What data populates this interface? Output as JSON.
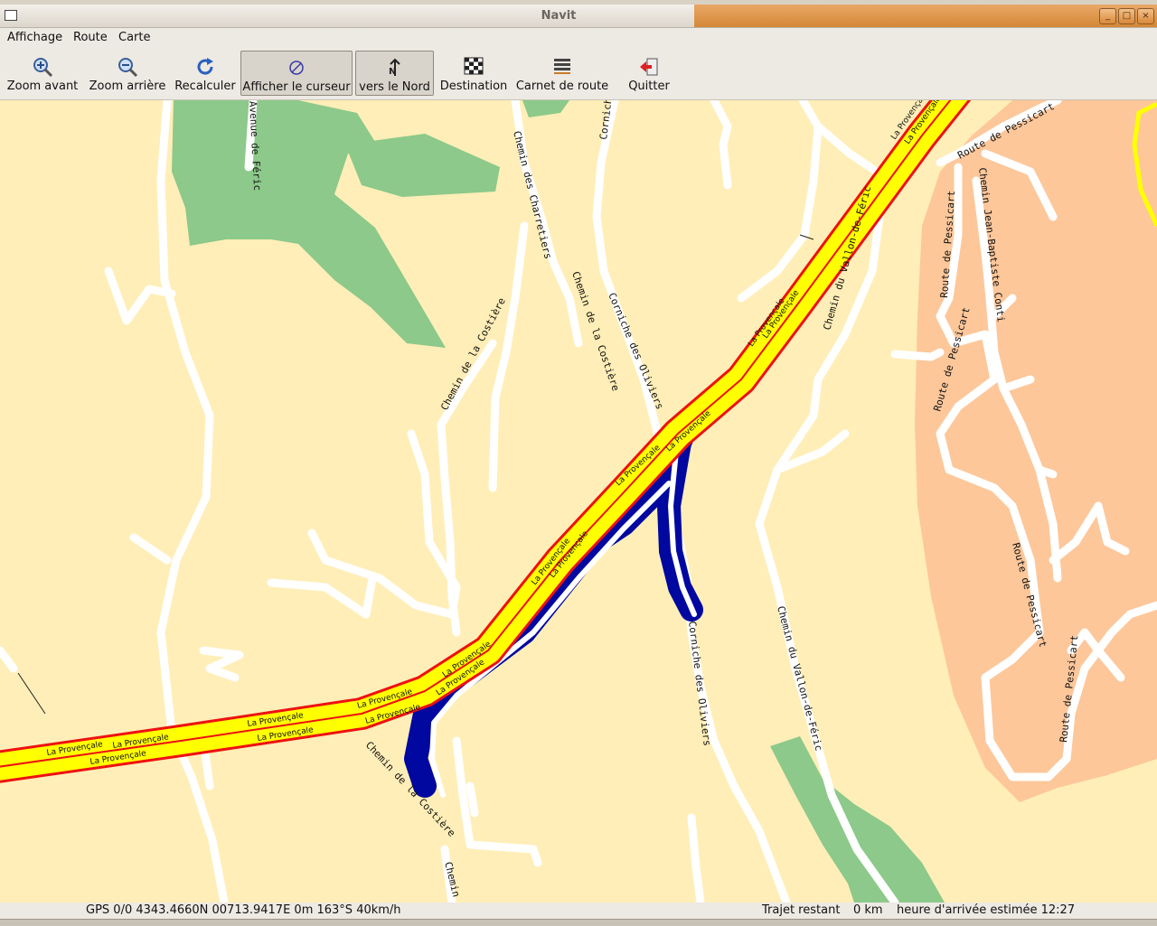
{
  "window": {
    "title": "Navit",
    "controls": [
      "_",
      "□",
      "×"
    ]
  },
  "menu": {
    "items": [
      {
        "label": "Affichage"
      },
      {
        "label": "Route"
      },
      {
        "label": "Carte"
      }
    ]
  },
  "toolbar": {
    "zoom_in": "Zoom avant",
    "zoom_out": "Zoom arrière",
    "recalculate": "Recalculer",
    "show_cursor": "Afficher le curseur",
    "north": "vers le Nord",
    "destination": "Destination",
    "roadbook": "Carnet de route",
    "quit": "Quitter"
  },
  "map": {
    "colors": {
      "land": "#ffeeb7",
      "park": "#8cc98a",
      "urban": "#fdc79a",
      "motorway_fill": "#ffff00",
      "motorway_edge": "#ee1111",
      "route": "#0008a0",
      "road": "#ffffff"
    },
    "labels": {
      "avenue_feric": "Avenue de Féric",
      "chemin_charretiers": "Chemin des Charretiers",
      "corniche_top": "Corniche",
      "chemin_costiere_1": "Chemin de la Costière",
      "chemin_costiere_2": "Chemin de la Costière",
      "corniche_oliviers_1": "Corniche des Oliviers",
      "corniche_oliviers_2": "Corniche des Oliviers",
      "chemin_costiere_3": "Chemin de la Costière",
      "chemin_bottom": "Chemin",
      "vallon_1": "Chemin du Vallon-de-Féric",
      "vallon_2": "Chemin du Vallon-de-Féric",
      "route_pessicart_top": "Route de Pessicart",
      "route_pessicart_2": "Route de Pessicart",
      "route_pessicart_3": "Route de Pessicart",
      "route_pessicart_4": "Route de Pessicart",
      "route_pessicart_5": "Route de Pessicart",
      "chemin_conti": "Chemin Jean-Baptiste Conti",
      "provencale": "La Provençale"
    }
  },
  "status": {
    "gps": "GPS  0/0 4343.4660N 00713.9417E    0m 163°S   40km/h",
    "remaining_label": "Trajet restant",
    "remaining_value": "0 km",
    "eta": "heure d'arrivée estimée 12:27"
  }
}
